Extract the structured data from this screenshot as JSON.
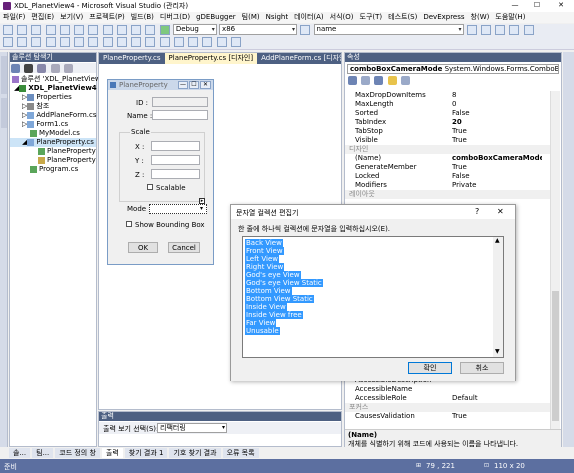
{
  "window": {
    "title": "XDL_PlanetView4 - Microsoft Visual Studio (관리자)"
  },
  "menu": [
    "파일(F)",
    "편집(E)",
    "보기(V)",
    "프로젝트(P)",
    "빌드(B)",
    "디버그(D)",
    "gDEBugger",
    "팀(M)",
    "Nsight",
    "데이터(A)",
    "서식(O)",
    "도구(T)",
    "테스트(S)",
    "DevExpress",
    "창(W)",
    "도움말(H)"
  ],
  "toolbar": {
    "config": "Debug",
    "platform": "x86",
    "find": "name"
  },
  "solution_explorer": {
    "title": "솔루션 탐색기",
    "items": [
      "솔루션 'XDL_PlanetView4' (1개 프로젝트)",
      "XDL_PlanetView4",
      "Properties",
      "참조",
      "AddPlaneForm.cs",
      "Form1.cs",
      "MyModel.cs",
      "PlaneProperty.cs",
      "PlaneProperty",
      "PlaneProperty",
      "Program.cs"
    ]
  },
  "editor_tabs": [
    "PlaneProperty.cs",
    "PlaneProperty.cs [디자인]",
    "AddPlaneForm.cs [디자인]"
  ],
  "form": {
    "title": "PlaneProperty",
    "id_label": "ID :",
    "name_label": "Name :",
    "scale_group": "Scale",
    "x_label": "X :",
    "y_label": "Y :",
    "z_label": "Z :",
    "scalable_label": "Scalable",
    "mode_label": "Mode :",
    "bounding_label": "Show Bounding Box",
    "ok_label": "OK",
    "cancel_label": "Cancel"
  },
  "properties": {
    "title": "속성",
    "object_name": "comboBoxCameraMode",
    "object_type": "System.Windows.Forms.ComboBox",
    "rows": [
      {
        "name": "MaxDropDownItems",
        "value": "8"
      },
      {
        "name": "MaxLength",
        "value": "0"
      },
      {
        "name": "Sorted",
        "value": "False"
      },
      {
        "name": "TabIndex",
        "value": "20"
      },
      {
        "name": "TabStop",
        "value": "True"
      },
      {
        "name": "Visible",
        "value": "True"
      },
      {
        "name": "디자인",
        "value": ""
      },
      {
        "name": "(Name)",
        "value": "comboBoxCameraMode"
      },
      {
        "name": "GenerateMember",
        "value": "True"
      },
      {
        "name": "Locked",
        "value": "False"
      },
      {
        "name": "Modifiers",
        "value": "Private"
      },
      {
        "name": "레이아웃",
        "value": ""
      }
    ],
    "bottom_rows": [
      {
        "name": "AccessibleDescription",
        "value": ""
      },
      {
        "name": "AccessibleName",
        "value": ""
      },
      {
        "name": "AccessibleRole",
        "value": "Default"
      },
      {
        "name": "포커스",
        "value": ""
      },
      {
        "name": "CausesValidation",
        "value": "True"
      }
    ],
    "desc_title": "(Name)",
    "desc_text": "개체를 식별하기 위해 코드에 사용되는 이름을 나타냅니다."
  },
  "dialog": {
    "title": "문자열 컬렉션 편집기",
    "instruction": "한 줄에 하나씩 컬렉션에 문자열을 입력하십시오(E).",
    "items": [
      "Back View",
      "Front View",
      "Left View",
      "Right View",
      "God's eye View",
      "God's eye View Static",
      "Bottom View",
      "Bottom View Static",
      "Inside View",
      "Inside View free",
      "Far View",
      "Unusable"
    ],
    "ok": "확인",
    "cancel": "취소",
    "help": "?",
    "close": "✕"
  },
  "output": {
    "title": "출력",
    "source_label": "출력 보기 선택(S):",
    "source_value": "리팩터링"
  },
  "bottom_tabs": [
    "솔...",
    "팀...",
    "코드 정의 창",
    "출력",
    "찾기 결과 1",
    "기호 찾기 결과",
    "오류 목록"
  ],
  "status": {
    "left": "준비",
    "pos": "79 , 221",
    "size": "110 x 20"
  }
}
